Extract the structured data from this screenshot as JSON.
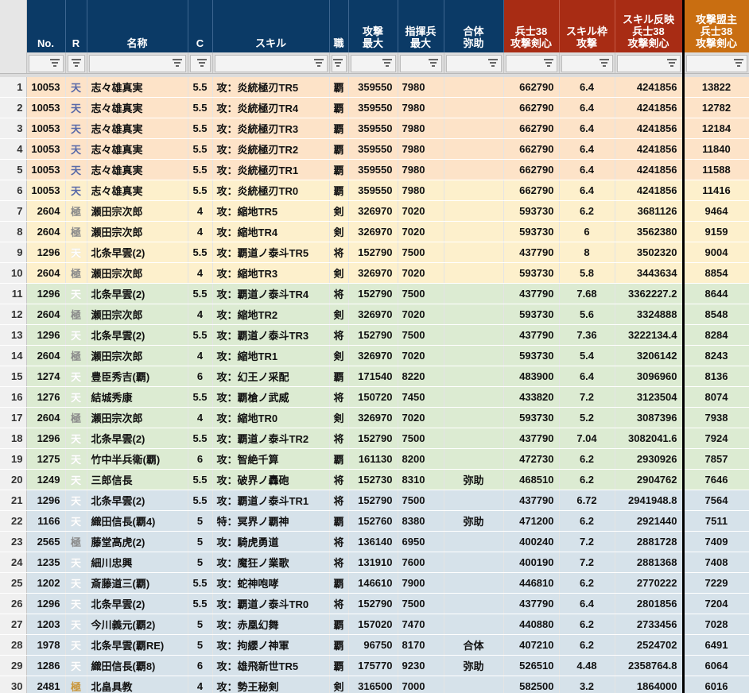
{
  "headers": {
    "no": "No.",
    "r": "R",
    "name": "名称",
    "c": "C",
    "skill": "スキル",
    "job": "職",
    "atk": [
      "攻撃",
      "最大"
    ],
    "cmd": [
      "指揮兵",
      "最大"
    ],
    "combo": [
      "合体",
      "弥助"
    ],
    "h38": [
      "兵士38",
      "攻撃剣心"
    ],
    "slot": [
      "スキル枠",
      "攻撃"
    ],
    "refl": [
      "スキル反映",
      "兵士38",
      "攻撃剣心"
    ],
    "alli": [
      "攻撃盟主",
      "兵士38",
      "攻撃剣心"
    ]
  },
  "rows": [
    {
      "n": "1",
      "no": "10053",
      "r": "天",
      "name": "志々雄真実",
      "c": "5.5",
      "skill": "攻：炎統極刃TR5",
      "job": "覇",
      "atk": "359550",
      "cmd": "7980",
      "combo": "",
      "h38": "662790",
      "slot": "6.4",
      "refl": "4241856",
      "alli": "13822"
    },
    {
      "n": "2",
      "no": "10053",
      "r": "天",
      "name": "志々雄真実",
      "c": "5.5",
      "skill": "攻：炎統極刃TR4",
      "job": "覇",
      "atk": "359550",
      "cmd": "7980",
      "combo": "",
      "h38": "662790",
      "slot": "6.4",
      "refl": "4241856",
      "alli": "12782"
    },
    {
      "n": "3",
      "no": "10053",
      "r": "天",
      "name": "志々雄真実",
      "c": "5.5",
      "skill": "攻：炎統極刃TR3",
      "job": "覇",
      "atk": "359550",
      "cmd": "7980",
      "combo": "",
      "h38": "662790",
      "slot": "6.4",
      "refl": "4241856",
      "alli": "12184"
    },
    {
      "n": "4",
      "no": "10053",
      "r": "天",
      "name": "志々雄真実",
      "c": "5.5",
      "skill": "攻：炎統極刃TR2",
      "job": "覇",
      "atk": "359550",
      "cmd": "7980",
      "combo": "",
      "h38": "662790",
      "slot": "6.4",
      "refl": "4241856",
      "alli": "11840"
    },
    {
      "n": "5",
      "no": "10053",
      "r": "天",
      "name": "志々雄真実",
      "c": "5.5",
      "skill": "攻：炎統極刃TR1",
      "job": "覇",
      "atk": "359550",
      "cmd": "7980",
      "combo": "",
      "h38": "662790",
      "slot": "6.4",
      "refl": "4241856",
      "alli": "11588"
    },
    {
      "n": "6",
      "no": "10053",
      "r": "天",
      "name": "志々雄真実",
      "c": "5.5",
      "skill": "攻：炎統極刃TR0",
      "job": "覇",
      "atk": "359550",
      "cmd": "7980",
      "combo": "",
      "h38": "662790",
      "slot": "6.4",
      "refl": "4241856",
      "alli": "11416"
    },
    {
      "n": "7",
      "no": "2604",
      "r": "極",
      "name": "瀬田宗次郎",
      "c": "4",
      "skill": "攻：縮地TR5",
      "job": "剣",
      "atk": "326970",
      "cmd": "7020",
      "combo": "",
      "h38": "593730",
      "slot": "6.2",
      "refl": "3681126",
      "alli": "9464"
    },
    {
      "n": "8",
      "no": "2604",
      "r": "極",
      "name": "瀬田宗次郎",
      "c": "4",
      "skill": "攻：縮地TR4",
      "job": "剣",
      "atk": "326970",
      "cmd": "7020",
      "combo": "",
      "h38": "593730",
      "slot": "6",
      "refl": "3562380",
      "alli": "9159"
    },
    {
      "n": "9",
      "no": "1296",
      "r": "天",
      "name": "北条早雲(2)",
      "c": "5.5",
      "skill": "攻：覇道ノ泰斗TR5",
      "job": "将",
      "atk": "152790",
      "cmd": "7500",
      "combo": "",
      "h38": "437790",
      "slot": "8",
      "refl": "3502320",
      "alli": "9004"
    },
    {
      "n": "10",
      "no": "2604",
      "r": "極",
      "name": "瀬田宗次郎",
      "c": "4",
      "skill": "攻：縮地TR3",
      "job": "剣",
      "atk": "326970",
      "cmd": "7020",
      "combo": "",
      "h38": "593730",
      "slot": "5.8",
      "refl": "3443634",
      "alli": "8854"
    },
    {
      "n": "11",
      "no": "1296",
      "r": "天",
      "name": "北条早雲(2)",
      "c": "5.5",
      "skill": "攻：覇道ノ泰斗TR4",
      "job": "将",
      "atk": "152790",
      "cmd": "7500",
      "combo": "",
      "h38": "437790",
      "slot": "7.68",
      "refl": "3362227.2",
      "alli": "8644"
    },
    {
      "n": "12",
      "no": "2604",
      "r": "極",
      "name": "瀬田宗次郎",
      "c": "4",
      "skill": "攻：縮地TR2",
      "job": "剣",
      "atk": "326970",
      "cmd": "7020",
      "combo": "",
      "h38": "593730",
      "slot": "5.6",
      "refl": "3324888",
      "alli": "8548"
    },
    {
      "n": "13",
      "no": "1296",
      "r": "天",
      "name": "北条早雲(2)",
      "c": "5.5",
      "skill": "攻：覇道ノ泰斗TR3",
      "job": "将",
      "atk": "152790",
      "cmd": "7500",
      "combo": "",
      "h38": "437790",
      "slot": "7.36",
      "refl": "3222134.4",
      "alli": "8284"
    },
    {
      "n": "14",
      "no": "2604",
      "r": "極",
      "name": "瀬田宗次郎",
      "c": "4",
      "skill": "攻：縮地TR1",
      "job": "剣",
      "atk": "326970",
      "cmd": "7020",
      "combo": "",
      "h38": "593730",
      "slot": "5.4",
      "refl": "3206142",
      "alli": "8243"
    },
    {
      "n": "15",
      "no": "1274",
      "r": "天",
      "name": "豊臣秀吉(覇)",
      "c": "6",
      "skill": "攻：幻王ノ采配",
      "job": "覇",
      "atk": "171540",
      "cmd": "8220",
      "combo": "",
      "h38": "483900",
      "slot": "6.4",
      "refl": "3096960",
      "alli": "8136"
    },
    {
      "n": "16",
      "no": "1276",
      "r": "天",
      "name": "結城秀康",
      "c": "5.5",
      "skill": "攻：覇槍ノ武威",
      "job": "将",
      "atk": "150720",
      "cmd": "7450",
      "combo": "",
      "h38": "433820",
      "slot": "7.2",
      "refl": "3123504",
      "alli": "8074"
    },
    {
      "n": "17",
      "no": "2604",
      "r": "極",
      "name": "瀬田宗次郎",
      "c": "4",
      "skill": "攻：縮地TR0",
      "job": "剣",
      "atk": "326970",
      "cmd": "7020",
      "combo": "",
      "h38": "593730",
      "slot": "5.2",
      "refl": "3087396",
      "alli": "7938"
    },
    {
      "n": "18",
      "no": "1296",
      "r": "天",
      "name": "北条早雲(2)",
      "c": "5.5",
      "skill": "攻：覇道ノ泰斗TR2",
      "job": "将",
      "atk": "152790",
      "cmd": "7500",
      "combo": "",
      "h38": "437790",
      "slot": "7.04",
      "refl": "3082041.6",
      "alli": "7924"
    },
    {
      "n": "19",
      "no": "1275",
      "r": "天",
      "name": "竹中半兵衛(覇)",
      "c": "6",
      "skill": "攻：智絶千算",
      "job": "覇",
      "atk": "161130",
      "cmd": "8200",
      "combo": "",
      "h38": "472730",
      "slot": "6.2",
      "refl": "2930926",
      "alli": "7857"
    },
    {
      "n": "20",
      "no": "1249",
      "r": "天",
      "name": "三郎信長",
      "c": "5.5",
      "skill": "攻：破界ノ轟砲",
      "job": "将",
      "atk": "152730",
      "cmd": "8310",
      "combo": "弥助",
      "h38": "468510",
      "slot": "6.2",
      "refl": "2904762",
      "alli": "7646"
    },
    {
      "n": "21",
      "no": "1296",
      "r": "天",
      "name": "北条早雲(2)",
      "c": "5.5",
      "skill": "攻：覇道ノ泰斗TR1",
      "job": "将",
      "atk": "152790",
      "cmd": "7500",
      "combo": "",
      "h38": "437790",
      "slot": "6.72",
      "refl": "2941948.8",
      "alli": "7564"
    },
    {
      "n": "22",
      "no": "1166",
      "r": "天",
      "name": "織田信長(覇4)",
      "c": "5",
      "skill": "特：冥界ノ覇神",
      "job": "覇",
      "atk": "152760",
      "cmd": "8380",
      "combo": "弥助",
      "h38": "471200",
      "slot": "6.2",
      "refl": "2921440",
      "alli": "7511"
    },
    {
      "n": "23",
      "no": "2565",
      "r": "極",
      "name": "藤堂高虎(2)",
      "c": "5",
      "skill": "攻：騎虎勇道",
      "job": "将",
      "atk": "136140",
      "cmd": "6950",
      "combo": "",
      "h38": "400240",
      "slot": "7.2",
      "refl": "2881728",
      "alli": "7409"
    },
    {
      "n": "24",
      "no": "1235",
      "r": "天",
      "name": "細川忠興",
      "c": "5",
      "skill": "攻：魔狂ノ業歌",
      "job": "将",
      "atk": "131910",
      "cmd": "7600",
      "combo": "",
      "h38": "400190",
      "slot": "7.2",
      "refl": "2881368",
      "alli": "7408"
    },
    {
      "n": "25",
      "no": "1202",
      "r": "天",
      "name": "斎藤道三(覇)",
      "c": "5.5",
      "skill": "攻：蛇神咆哮",
      "job": "覇",
      "atk": "146610",
      "cmd": "7900",
      "combo": "",
      "h38": "446810",
      "slot": "6.2",
      "refl": "2770222",
      "alli": "7229"
    },
    {
      "n": "26",
      "no": "1296",
      "r": "天",
      "name": "北条早雲(2)",
      "c": "5.5",
      "skill": "攻：覇道ノ泰斗TR0",
      "job": "将",
      "atk": "152790",
      "cmd": "7500",
      "combo": "",
      "h38": "437790",
      "slot": "6.4",
      "refl": "2801856",
      "alli": "7204"
    },
    {
      "n": "27",
      "no": "1203",
      "r": "天",
      "name": "今川義元(覇2)",
      "c": "5",
      "skill": "攻：赤凰幻舞",
      "job": "覇",
      "atk": "157020",
      "cmd": "7470",
      "combo": "",
      "h38": "440880",
      "slot": "6.2",
      "refl": "2733456",
      "alli": "7028"
    },
    {
      "n": "28",
      "no": "1978",
      "r": "天",
      "name": "北条早雲(覇RE)",
      "c": "5",
      "skill": "攻：拘纓ノ神軍",
      "job": "覇",
      "atk": "96750",
      "cmd": "8170",
      "combo": "合体",
      "h38": "407210",
      "slot": "6.2",
      "refl": "2524702",
      "alli": "6491"
    },
    {
      "n": "29",
      "no": "1286",
      "r": "天",
      "name": "織田信長(覇8)",
      "c": "6",
      "skill": "攻：雄飛新世TR5",
      "job": "覇",
      "atk": "175770",
      "cmd": "9230",
      "combo": "弥助",
      "h38": "526510",
      "slot": "4.48",
      "refl": "2358764.8",
      "alli": "6064"
    },
    {
      "n": "30",
      "no": "2481",
      "r": "極",
      "name": "北畠具教",
      "c": "4",
      "skill": "攻：勢王秘剣",
      "job": "剣",
      "atk": "316500",
      "cmd": "7000",
      "combo": "",
      "h38": "582500",
      "slot": "3.2",
      "refl": "1864000",
      "alli": "6016"
    }
  ],
  "colors": {
    "header_blue": "#0b3a66",
    "header_red": "#a82c14",
    "header_orange": "#c96e11",
    "band_orange": "#fde3c8",
    "band_yellow": "#fdf0cc",
    "band_green": "#dcebd2",
    "band_blue": "#d6e2ea"
  },
  "icons": {
    "filter": "filter-icon"
  }
}
